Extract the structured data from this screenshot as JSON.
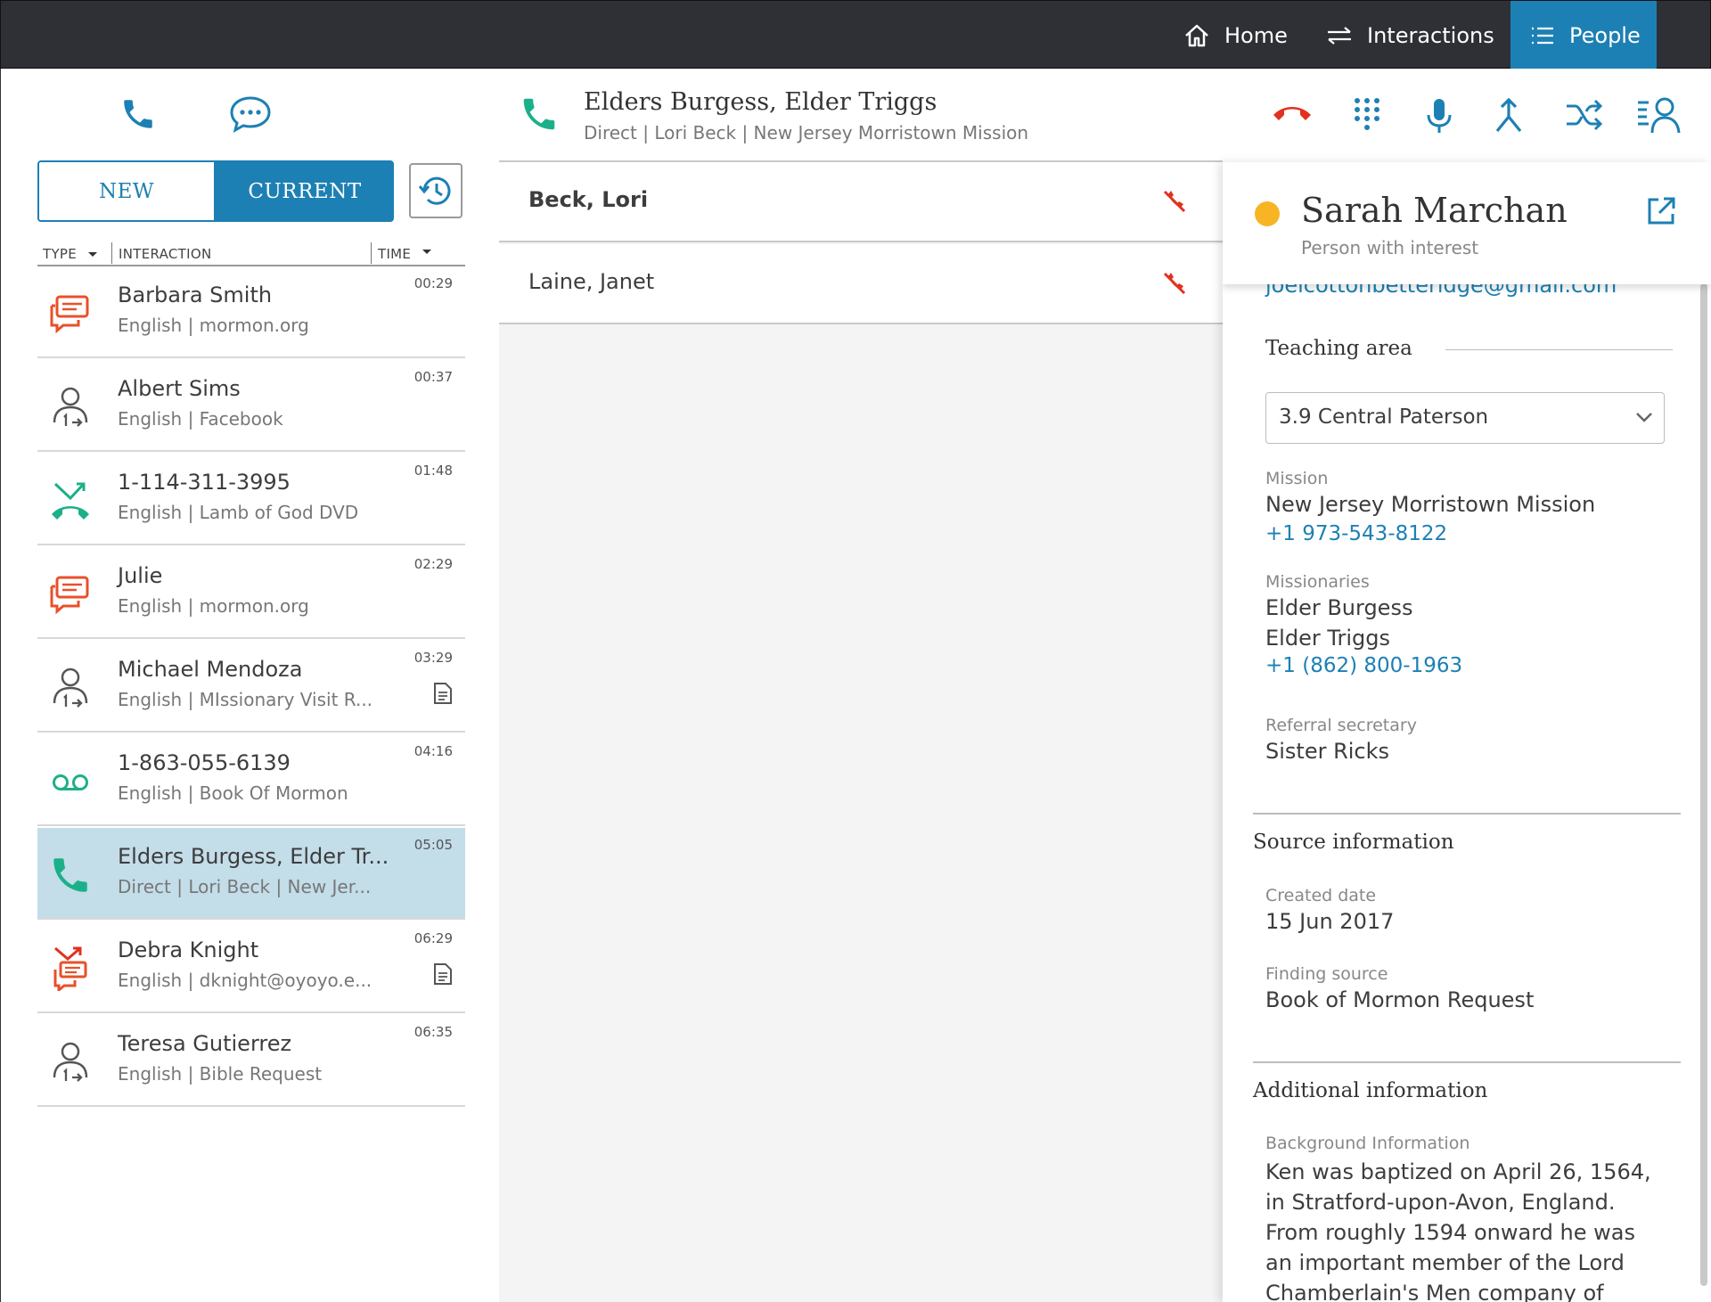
{
  "nav": {
    "items": [
      {
        "label": "Home",
        "icon": "home-icon"
      },
      {
        "label": "Interactions",
        "icon": "swap-arrows-icon"
      },
      {
        "label": "People",
        "icon": "list-icon",
        "active": true
      }
    ]
  },
  "channels": {
    "phone_icon": "phone-icon",
    "chat_icon": "chat-bubble-icon"
  },
  "tabs": {
    "new": "NEW",
    "current": "CURRENT",
    "history_icon": "history-icon"
  },
  "columns": {
    "type": "TYPE",
    "interaction": "INTERACTION",
    "time": "TIME"
  },
  "interactions": [
    {
      "name": "Barbara Smith",
      "sub": "English | mormon.org",
      "time": "00:29",
      "icon": "chat-icon",
      "doc": false
    },
    {
      "name": "Albert Sims",
      "sub": "English | Facebook",
      "time": "00:37",
      "icon": "person-transfer-icon",
      "doc": false
    },
    {
      "name": "1-114-311-3995",
      "sub": "English | Lamb of God DVD",
      "time": "01:48",
      "icon": "missed-call-icon",
      "doc": false
    },
    {
      "name": "Julie",
      "sub": "English | mormon.org",
      "time": "02:29",
      "icon": "chat-icon",
      "doc": false
    },
    {
      "name": "Michael Mendoza",
      "sub": "English | MIssionary Visit R...",
      "time": "03:29",
      "icon": "person-transfer-icon",
      "doc": true
    },
    {
      "name": "1-863-055-6139",
      "sub": "English | Book Of Mormon",
      "time": "04:16",
      "icon": "voicemail-icon",
      "doc": false
    },
    {
      "name": "Elders Burgess, Elder Tr...",
      "sub": "Direct | Lori Beck | New Jer...",
      "time": "05:05",
      "icon": "phone-icon",
      "doc": false,
      "selected": true
    },
    {
      "name": "Debra Knight",
      "sub": "English | dknight@oyoyo.e...",
      "time": "06:29",
      "icon": "missed-chat-icon",
      "doc": true
    },
    {
      "name": "Teresa Gutierrez",
      "sub": "English | Bible Request",
      "time": "06:35",
      "icon": "person-transfer-icon",
      "doc": false
    }
  ],
  "call": {
    "title": "Elders Burgess, Elder Triggs",
    "subtitle": "Direct | Lori Beck | New Jersey Morristown Mission",
    "controls": [
      "hangup-icon",
      "dialpad-icon",
      "microphone-icon",
      "merge-icon",
      "transfer-icon",
      "people-list-icon"
    ]
  },
  "participants": [
    {
      "name": "Beck, Lori",
      "bold": true
    },
    {
      "name": "Laine, Janet",
      "bold": false
    }
  ],
  "person": {
    "name": "Sarah Marchan",
    "role": "Person with interest",
    "status_color": "#f7b524",
    "email": "joelcottonbetteridge@gmail.com",
    "teaching_area_title": "Teaching area",
    "teaching_area_value": "3.9 Central Paterson",
    "mission_label": "Mission",
    "mission_value": "New Jersey Morristown Mission",
    "mission_phone": "+1 973-543-8122",
    "missionaries_label": "Missionaries",
    "missionary_1": "Elder Burgess",
    "missionary_2": "Elder Triggs",
    "missionaries_phone": "+1 (862) 800-1963",
    "referral_label": "Referral secretary",
    "referral_value": "Sister Ricks",
    "source_title": "Source information",
    "created_label": "Created date",
    "created_value": "15 Jun 2017",
    "finding_label": "Finding source",
    "finding_value": "Book of Mormon Request",
    "additional_title": "Additional information",
    "background_label": "Background Information",
    "background_value": "Ken was baptized on April 26, 1564, in Stratford-upon-Avon, England. From roughly 1594 onward he was an important member of the Lord Chamberlain's Men company of"
  },
  "colors": {
    "accent": "#1d80b4",
    "topbar": "#2e3035",
    "selected_row": "#c3dde9",
    "green": "#1cb08a",
    "red": "#e0321f",
    "orange": "#e8502a"
  }
}
